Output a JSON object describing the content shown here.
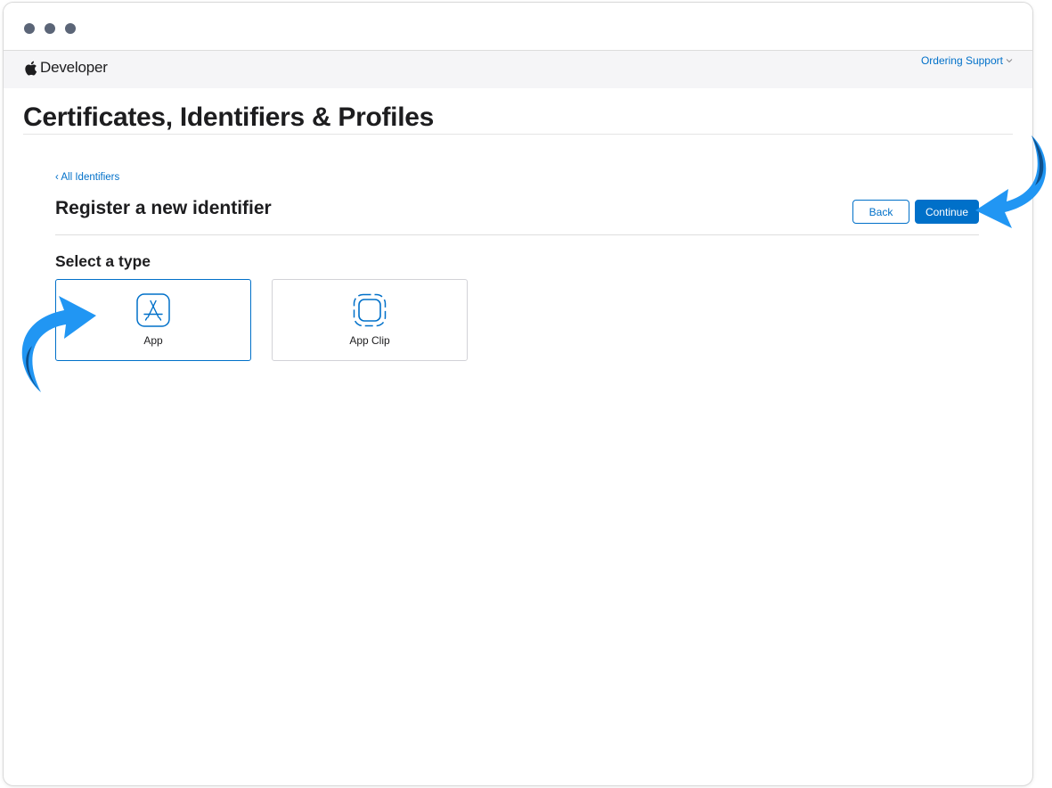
{
  "window": {
    "controls": [
      "close",
      "minimize",
      "zoom"
    ]
  },
  "header": {
    "brand_label": "Developer",
    "brand_icon": "apple-icon",
    "ordering_support": "Ordering Support"
  },
  "page": {
    "title": "Certificates, Identifiers & Profiles"
  },
  "section": {
    "back_link": "‹ All Identifiers",
    "title": "Register a new identifier",
    "back_button": "Back",
    "continue_button": "Continue"
  },
  "type_selector": {
    "title": "Select a type",
    "options": [
      {
        "label": "App",
        "icon": "app-store-icon",
        "selected": true
      },
      {
        "label": "App Clip",
        "icon": "app-clip-icon",
        "selected": false
      }
    ]
  },
  "colors": {
    "accent": "#0070c9",
    "annotation_arrow": "#2196f3",
    "annotation_arrow_dark": "#0d4f8b",
    "window_dot": "#5b6577"
  },
  "annotations": {
    "arrows": [
      "arrow-to-continue-button",
      "arrow-to-app-card"
    ]
  }
}
